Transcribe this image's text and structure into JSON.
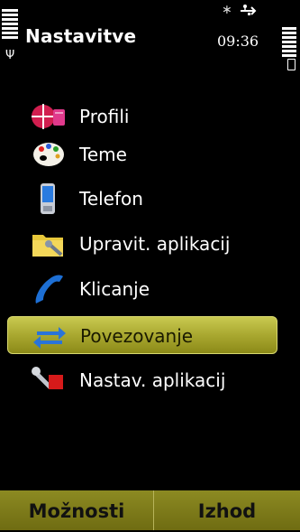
{
  "status": {
    "title": "Nastavitve",
    "time": "09:36"
  },
  "menu": {
    "selected_index": 5,
    "items": [
      {
        "label": "Profili",
        "icon": "profiles-icon"
      },
      {
        "label": "Teme",
        "icon": "themes-palette-icon"
      },
      {
        "label": "Telefon",
        "icon": "phone-icon"
      },
      {
        "label": "Upravit. aplikacij",
        "icon": "app-manager-folder-icon"
      },
      {
        "label": "Klicanje",
        "icon": "call-handset-icon"
      },
      {
        "label": "Povezovanje",
        "icon": "connectivity-arrows-icon"
      },
      {
        "label": "Nastav. aplikacij",
        "icon": "app-settings-tools-icon"
      }
    ]
  },
  "softkeys": {
    "left": "Možnosti",
    "right": "Izhod"
  },
  "colors": {
    "highlight": "#b2b03a",
    "softkey_bar": "#7e7b1a",
    "background": "#000000"
  }
}
